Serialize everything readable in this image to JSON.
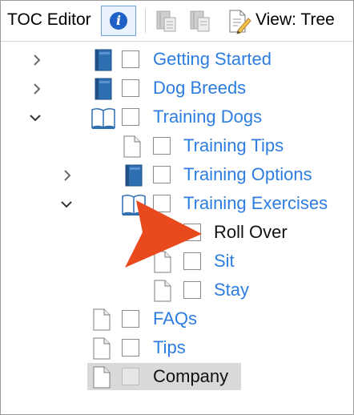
{
  "toolbar": {
    "title": "TOC Editor",
    "info_icon": "info-icon",
    "info_glyph": "i",
    "view_label": "View: Tree"
  },
  "tree": {
    "items": [
      {
        "label": "Getting Started",
        "icon": "book-closed",
        "expander": "collapsed",
        "level": 0
      },
      {
        "label": "Dog Breeds",
        "icon": "book-closed",
        "expander": "collapsed",
        "level": 0
      },
      {
        "label": "Training Dogs",
        "icon": "book-open",
        "expander": "expanded",
        "level": 0
      },
      {
        "label": "Training Tips",
        "icon": "page",
        "expander": "none",
        "level": 1
      },
      {
        "label": "Training Options",
        "icon": "book-closed",
        "expander": "collapsed",
        "level": 1
      },
      {
        "label": "Training Exercises",
        "icon": "book-open",
        "expander": "expanded",
        "level": 1
      },
      {
        "label": "Roll Over",
        "icon": "page",
        "expander": "none",
        "level": 2
      },
      {
        "label": "Sit",
        "icon": "page",
        "expander": "none",
        "level": 2
      },
      {
        "label": "Stay",
        "icon": "page",
        "expander": "none",
        "level": 2
      },
      {
        "label": "FAQs",
        "icon": "page",
        "expander": "none",
        "level": 0
      },
      {
        "label": "Tips",
        "icon": "page",
        "expander": "none",
        "level": 0
      },
      {
        "label": "Company",
        "icon": "page",
        "expander": "none",
        "level": 0,
        "selected": true
      }
    ]
  },
  "colors": {
    "link": "#2d7de0",
    "arrow": "#e8491d",
    "book": "#2e6fb2",
    "selected": "#d9d9d9"
  }
}
